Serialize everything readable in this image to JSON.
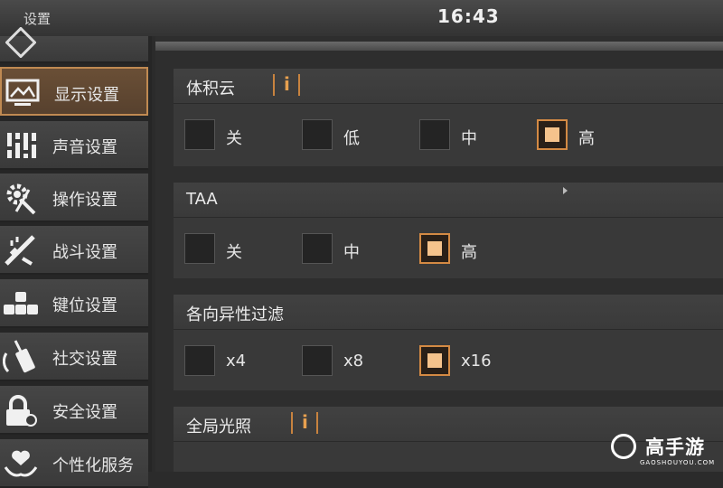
{
  "window": {
    "title": "设置",
    "clock": "16:43"
  },
  "sidebar": {
    "items": [
      {
        "label": "",
        "icon": "partial-icon",
        "active": false
      },
      {
        "label": "显示设置",
        "icon": "monitor-icon",
        "active": true
      },
      {
        "label": "声音设置",
        "icon": "equalizer-icon",
        "active": false
      },
      {
        "label": "操作设置",
        "icon": "gear-icon",
        "active": false
      },
      {
        "label": "战斗设置",
        "icon": "rifle-icon",
        "active": false
      },
      {
        "label": "键位设置",
        "icon": "keyboard-icon",
        "active": false
      },
      {
        "label": "社交设置",
        "icon": "walkie-talkie-icon",
        "active": false
      },
      {
        "label": "安全设置",
        "icon": "lock-icon",
        "active": false
      },
      {
        "label": "个性化服务",
        "icon": "heart-hand-icon",
        "active": false
      }
    ]
  },
  "settings": {
    "volumetric_clouds": {
      "label": "体积云",
      "info": "i",
      "options": [
        {
          "label": "关",
          "checked": false
        },
        {
          "label": "低",
          "checked": false
        },
        {
          "label": "中",
          "checked": false
        },
        {
          "label": "高",
          "checked": true
        }
      ]
    },
    "taa": {
      "label": "TAA",
      "options": [
        {
          "label": "关",
          "checked": false
        },
        {
          "label": "中",
          "checked": false
        },
        {
          "label": "高",
          "checked": true
        }
      ]
    },
    "anisotropic": {
      "label": "各向异性过滤",
      "options": [
        {
          "label": "x4",
          "checked": false
        },
        {
          "label": "x8",
          "checked": false
        },
        {
          "label": "x16",
          "checked": true
        }
      ]
    },
    "global_illumination": {
      "label": "全局光照",
      "info": "i"
    }
  },
  "watermark": {
    "text": "高手游",
    "sub": "GAOSHOUYOU.COM"
  },
  "colors": {
    "accent": "#d48a44",
    "active_bg": "#5f4632",
    "checked_fill": "#f5c38c"
  }
}
